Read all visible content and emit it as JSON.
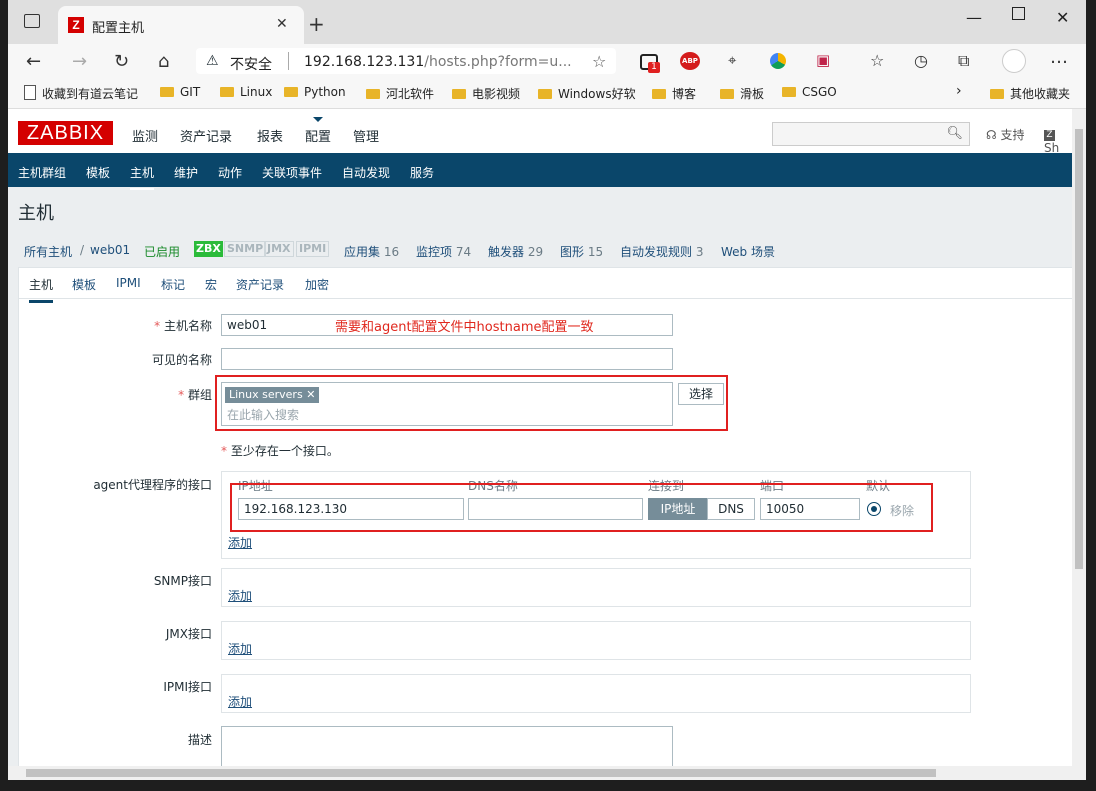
{
  "browser": {
    "tab_title": "配置主机",
    "tab_favicon": "Z",
    "insecure_label": "不安全",
    "url_host": "192.168.123.131",
    "url_rest": "/hosts.php?form=u...",
    "ext_badge": "1",
    "abp": "ABP",
    "bookmarks": [
      "收藏到有道云笔记",
      "GIT",
      "Linux",
      "Python",
      "河北软件",
      "电影视频",
      "Windows好软",
      "博客",
      "滑板",
      "CSGO"
    ],
    "other_bookmarks": "其他收藏夹"
  },
  "zabbix": {
    "logo": "ZABBIX",
    "top_menu": [
      "监测",
      "资产记录",
      "报表",
      "配置",
      "管理"
    ],
    "support": "支持",
    "share": "Sh",
    "sub_menu": [
      "主机群组",
      "模板",
      "主机",
      "维护",
      "动作",
      "关联项事件",
      "自动发现",
      "服务"
    ],
    "page_title": "主机"
  },
  "hostbar": {
    "all_hosts": "所有主机",
    "sep": "/",
    "host": "web01",
    "enabled": "已启用",
    "avail": [
      "ZBX",
      "SNMP",
      "JMX",
      "IPMI"
    ],
    "links": [
      {
        "label": "应用集",
        "count": "16"
      },
      {
        "label": "监控项",
        "count": "74"
      },
      {
        "label": "触发器",
        "count": "29"
      },
      {
        "label": "图形",
        "count": "15"
      },
      {
        "label": "自动发现规则",
        "count": "3"
      },
      {
        "label": "Web 场景",
        "count": ""
      }
    ]
  },
  "form": {
    "tabs": [
      "主机",
      "模板",
      "IPMI",
      "标记",
      "宏",
      "资产记录",
      "加密"
    ],
    "hostname_label": "主机名称",
    "hostname_value": "web01",
    "hostname_annotation": "需要和agent配置文件中hostname配置一致",
    "visible_name_label": "可见的名称",
    "visible_name_value": "",
    "groups_label": "群组",
    "group_tag": "Linux servers",
    "group_tag_remove": "✕",
    "group_placeholder": "在此输入搜索",
    "select_button": "选择",
    "interface_note_star": "*",
    "interface_note": "至少存在一个接口。",
    "agent_label": "agent代理程序的接口",
    "col_ip": "IP地址",
    "col_dns": "DNS名称",
    "col_connect": "连接到",
    "col_port": "端口",
    "col_default": "默认",
    "ip_value": "192.168.123.130",
    "dns_value": "",
    "connect_ip": "IP地址",
    "connect_dns": "DNS",
    "port_value": "10050",
    "remove": "移除",
    "add": "添加",
    "snmp_label": "SNMP接口",
    "jmx_label": "JMX接口",
    "ipmi_label": "IPMI接口",
    "desc_label": "描述",
    "required_star": "*"
  }
}
